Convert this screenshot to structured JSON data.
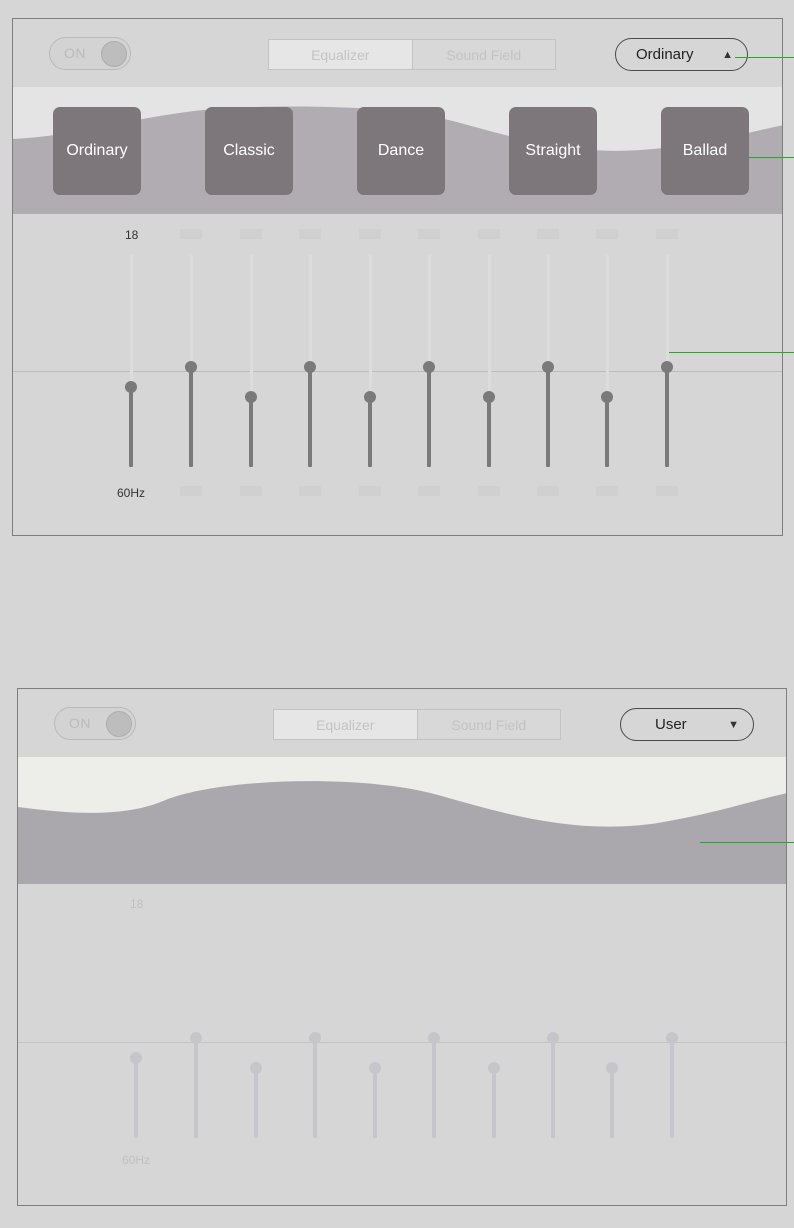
{
  "panel_top": {
    "toggle_label": "ON",
    "tabs": [
      {
        "label": "Equalizer",
        "active": true
      },
      {
        "label": "Sound Field",
        "active": false
      }
    ],
    "dropdown": {
      "value": "Ordinary",
      "caret": "▲"
    },
    "presets": [
      "Ordinary",
      "Classic",
      "Dance",
      "Straight",
      "Ballad"
    ],
    "eq": {
      "top_label": "18",
      "bottom_label": "60Hz",
      "slider_levels": [
        -0.2,
        0.0,
        -0.3,
        0.0,
        -0.3,
        0.0,
        -0.3,
        0.0,
        -0.3,
        0.0
      ]
    }
  },
  "panel_bottom": {
    "toggle_label": "ON",
    "tabs": [
      {
        "label": "Equalizer",
        "active": true
      },
      {
        "label": "Sound Field",
        "active": false
      }
    ],
    "dropdown": {
      "value": "User",
      "caret": "▼"
    },
    "eq": {
      "top_label": "18",
      "bottom_label": "60Hz",
      "slider_levels": [
        -0.2,
        0.0,
        -0.3,
        0.0,
        -0.3,
        0.0,
        -0.3,
        0.0,
        -0.3,
        0.0
      ]
    }
  },
  "colors": {
    "accent_line": "#2aa52a",
    "preset_button": "#7d777c",
    "slider_active": "#7a7a7a",
    "slider_disabled": "#c5c5cb"
  }
}
